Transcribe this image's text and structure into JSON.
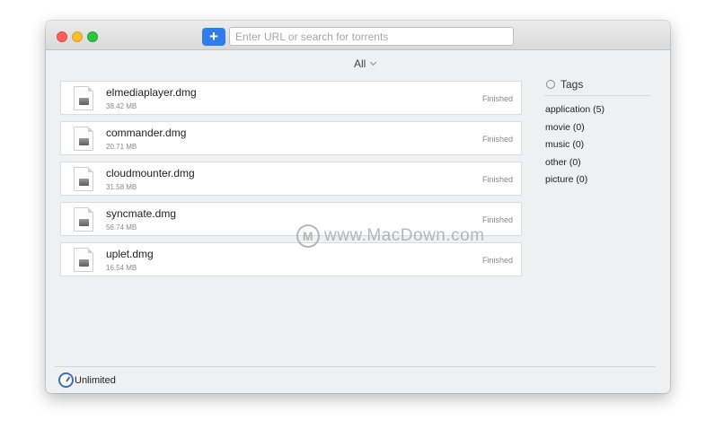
{
  "toolbar": {
    "add_label": "+",
    "search_placeholder": "Enter URL or search for torrents"
  },
  "filter": {
    "label": "All"
  },
  "torrents": [
    {
      "name": "elmediaplayer.dmg",
      "size": "38.42 MB",
      "status": "Finished"
    },
    {
      "name": "commander.dmg",
      "size": "20.71 MB",
      "status": "Finished"
    },
    {
      "name": "cloudmounter.dmg",
      "size": "31.58 MB",
      "status": "Finished"
    },
    {
      "name": "syncmate.dmg",
      "size": "56.74 MB",
      "status": "Finished"
    },
    {
      "name": "uplet.dmg",
      "size": "16.54 MB",
      "status": "Finished"
    }
  ],
  "tags": {
    "title": "Tags",
    "items": [
      {
        "label": "application (5)"
      },
      {
        "label": "movie (0)"
      },
      {
        "label": "music (0)"
      },
      {
        "label": "other (0)"
      },
      {
        "label": "picture (0)"
      }
    ]
  },
  "statusbar": {
    "speed_label": "Unlimited"
  },
  "watermark": {
    "logo": "M",
    "text": "www.MacDown.com"
  },
  "colors": {
    "accent": "#2f7dea",
    "window_bg": "#eef0f1"
  }
}
